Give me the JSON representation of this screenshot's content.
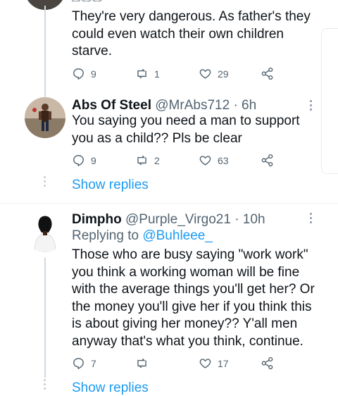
{
  "tweet1": {
    "text": "They're very dangerous. As father's they\ncould even watch their own children\nstarve.",
    "replies": "9",
    "retweets": "1",
    "likes": "29"
  },
  "tweet2": {
    "name": "Abs Of Steel",
    "handle": "@MrAbs712",
    "time": "· 6h",
    "text": "You saying you need a man to support\nyou as a child?? Pls be clear",
    "replies": "9",
    "retweets": "2",
    "likes": "63",
    "show_replies": "Show replies"
  },
  "tweet3": {
    "name": "Dimpho",
    "handle": "@Purple_Virgo21",
    "time": "· 10h",
    "replying_prefix": "Replying to ",
    "replying_to": "@Buhleee_",
    "text": "Those who are busy saying \"work work\"\nyou think a working woman will be fine\nwith the average things you'll get her? Or\nthe money you'll give her if you think this\nis about giving her money?? Y'all men\nanyway that's what you think, continue.",
    "replies": "7",
    "retweets": "",
    "likes": "17",
    "show_replies": "Show replies"
  },
  "colors": {
    "accent": "#1d9bf0",
    "text": "#0f1419",
    "muted": "#536471",
    "divider": "#eff3f4"
  },
  "icons": [
    "reply-icon",
    "retweet-icon",
    "like-icon",
    "share-icon",
    "more-icon"
  ]
}
